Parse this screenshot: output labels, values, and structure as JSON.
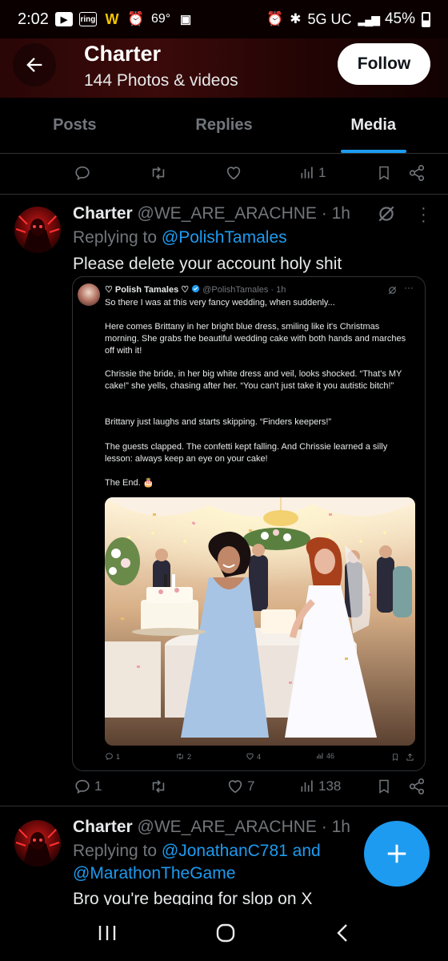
{
  "status": {
    "time": "2:02",
    "temp": "69°",
    "network": "5G UC",
    "battery": "45%",
    "ring_label": "ring"
  },
  "header": {
    "title": "Charter",
    "subtitle": "144 Photos & videos",
    "follow_label": "Follow"
  },
  "tabs": [
    {
      "label": "Posts"
    },
    {
      "label": "Replies"
    },
    {
      "label": "Media"
    }
  ],
  "top_actions": {
    "views": "1"
  },
  "post1": {
    "name": "Charter",
    "handle": "@WE_ARE_ARACHNE · 1h",
    "replying_prefix": "Replying to ",
    "replying_to": "@PolishTamales",
    "text": "Please delete your account holy shit",
    "quote": {
      "name": "♡ Polish Tamales ♡",
      "handle": "@PolishTamales · 1h",
      "p1": "So there I was at this very fancy wedding, when suddenly...",
      "p2": "Here comes Brittany in her bright blue dress, smiling like it's Christmas morning. She grabs the beautiful wedding cake with both hands and marches off with it!",
      "p3": "Chrissie the bride, in her big white dress and veil, looks shocked. “That's MY cake!” she yells, chasing after her. “You can't just take it you autistic bitch!”",
      "p4": "Brittany just laughs and starts skipping. “Finders keepers!”",
      "p5": "The guests clapped. The confetti kept falling. And Chrissie learned a silly lesson: always keep an eye on your cake!",
      "p6": "The End. 🎂",
      "replies": "1",
      "reposts": "2",
      "likes": "4",
      "views": "46"
    },
    "replies": "1",
    "reposts": "",
    "likes": "7",
    "views": "138"
  },
  "post2": {
    "name": "Charter",
    "handle": "@WE_ARE_ARACHNE · 1h",
    "replying_prefix": "Replying to ",
    "replying_to": "@JonathanC781 and",
    "replying_to2": "@MarathonTheGame",
    "text": "Bro you're begging for slop on X"
  },
  "colors": {
    "accent": "#1d9bf0",
    "muted": "#71767b",
    "text": "#e7e9ea"
  }
}
